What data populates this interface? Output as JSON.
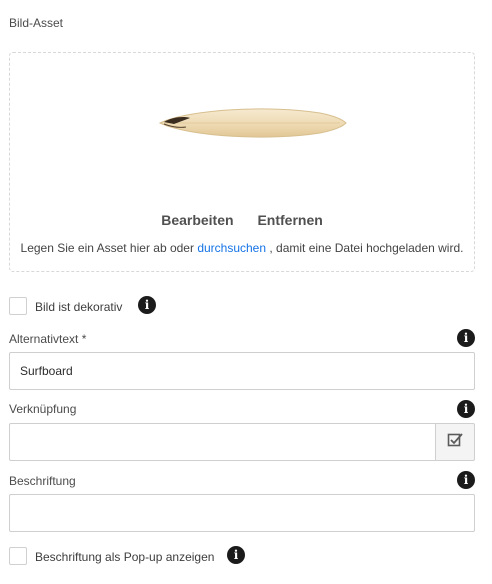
{
  "asset": {
    "label": "Bild-Asset",
    "edit_label": "Bearbeiten",
    "remove_label": "Entfernen",
    "hint_before": "Legen Sie ein Asset hier ab oder ",
    "hint_link": "durchsuchen",
    "hint_after": " , damit eine Datei hochgeladen wird."
  },
  "decorative": {
    "label": "Bild ist dekorativ",
    "checked": false
  },
  "alt_text": {
    "label": "Alternativtext *",
    "value": "Surfboard"
  },
  "link": {
    "label": "Verknüpfung",
    "value": ""
  },
  "caption": {
    "label": "Beschriftung",
    "value": ""
  },
  "caption_popup": {
    "label": "Beschriftung als Pop-up anzeigen",
    "checked": false
  },
  "icons": {
    "info": "info-icon",
    "picker": "checkbox-picker-icon",
    "thumbnail": "surfboard-image"
  }
}
